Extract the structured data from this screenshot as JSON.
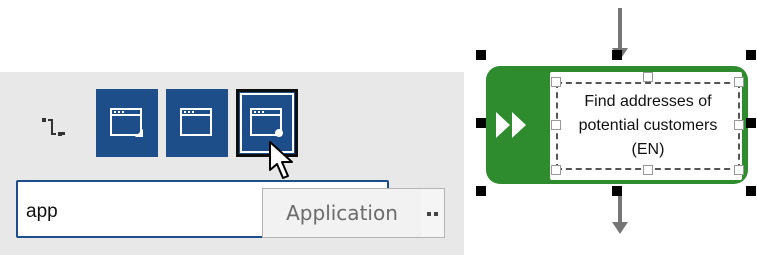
{
  "toolbar": {
    "icons": [
      "connector-icon",
      "window-application-icon",
      "window-icon",
      "window-record-icon"
    ]
  },
  "search": {
    "value": "app"
  },
  "autocomplete": {
    "suggestion": "Application"
  },
  "diagram": {
    "function_label_lines": [
      "Find addresses of",
      "potential customers",
      "(EN)"
    ],
    "function_color": "#2e8b2e"
  },
  "colors": {
    "button_blue": "#1d4e89",
    "panel_gray": "#e8e8e8"
  }
}
